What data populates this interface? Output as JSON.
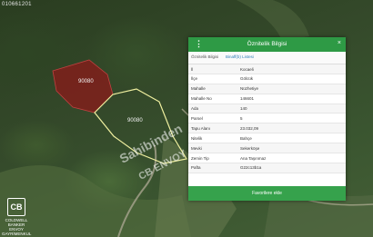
{
  "map": {
    "coordinate_readout": "010661201",
    "parcel_labels": [
      "90080",
      "90080"
    ]
  },
  "brand": {
    "logo_letters": "CB",
    "line1": "COLDWELL",
    "line2": "BANKER",
    "line3": "ENVOY",
    "line4": "GAYRİMENKUL"
  },
  "watermark": {
    "line1": "Sahibinden",
    "line2": "CB ENVOY"
  },
  "panel": {
    "menu_icon": "⋮",
    "title": "Öznitelik Bilgisi",
    "close_icon": "×",
    "tabs": [
      "Öznitelik Bilgisi",
      "Binaff(b) Listesi"
    ],
    "rows": [
      {
        "k": "İl",
        "v": "Kocaeli"
      },
      {
        "k": "İlçe",
        "v": "Gölcük"
      },
      {
        "k": "Mahalle",
        "v": "Nüzhetiye"
      },
      {
        "k": "Mahalle No",
        "v": "146601"
      },
      {
        "k": "Ada",
        "v": "140"
      },
      {
        "k": "Parsel",
        "v": "5"
      },
      {
        "k": "Tapu Alanı",
        "v": "23.032,09"
      },
      {
        "k": "Nitelik",
        "v": "Bahçe"
      },
      {
        "k": "Mevki",
        "v": "Sekerköşe"
      },
      {
        "k": "Zemin Tip",
        "v": "Ana Taşınmaz"
      },
      {
        "k": "Pafta",
        "v": "G22c13b1a"
      }
    ],
    "footer_button": "Favorilere ekle"
  },
  "colors": {
    "header": "#2e9a45",
    "footer": "#36a24c",
    "parcel_red": "#8b1a1a",
    "parcel_outline": "#f0f0a0"
  }
}
